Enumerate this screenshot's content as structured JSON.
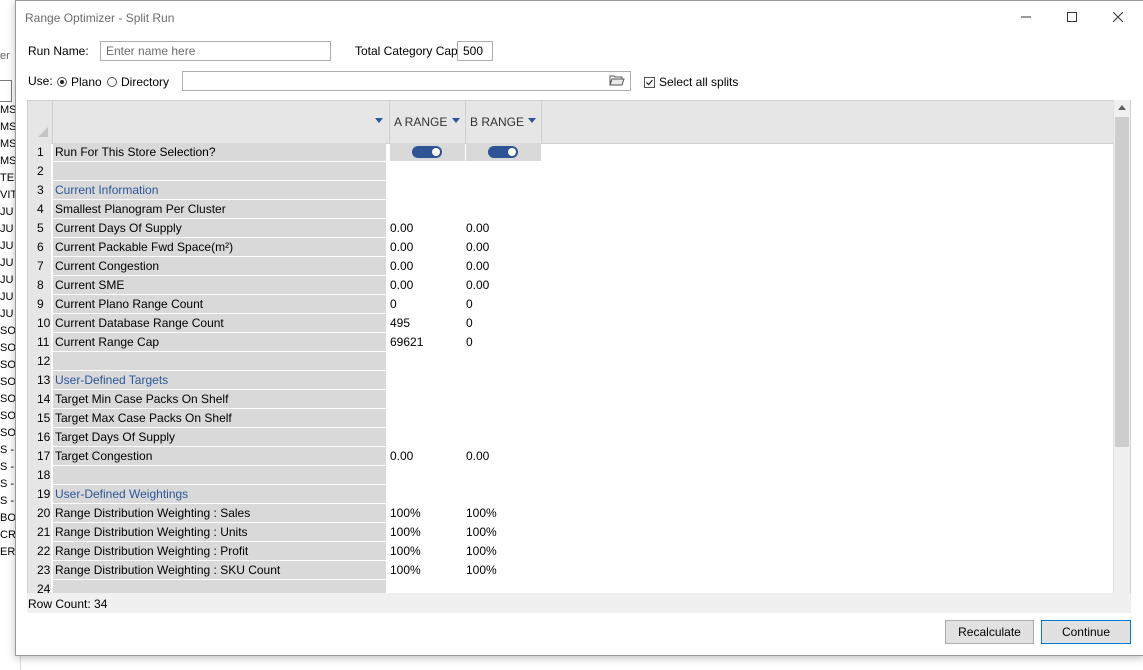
{
  "background_app": {
    "label": "er",
    "list": [
      "MS",
      "MS",
      "MS",
      "MS",
      "TEM",
      "VIT",
      "JU",
      "JU",
      "JU",
      "JU",
      "JU",
      "JU",
      "JU",
      "SO",
      "SO",
      "SO",
      "SO",
      "SO",
      "SO",
      "SO",
      "S - A",
      "S - E",
      "S - E",
      "S - E",
      "BOD",
      "CRE",
      "ERA"
    ]
  },
  "window": {
    "title": "Range Optimizer - Split Run",
    "minimize_icon": "minimize-icon",
    "maximize_icon": "maximize-icon",
    "close_icon": "close-icon"
  },
  "form": {
    "run_name_label": "Run Name:",
    "run_name_placeholder": "Enter name here",
    "run_name_value": "",
    "category_cap_label": "Total Category Cap:",
    "category_cap_value": "500",
    "use_label": "Use:",
    "use_options": [
      {
        "label": "Plano",
        "checked": true
      },
      {
        "label": "Directory",
        "checked": false
      }
    ],
    "path_value": "",
    "folder_icon": "folder-open-icon",
    "select_all_label": "Select all splits",
    "select_all_checked": true
  },
  "grid": {
    "columns": [
      "",
      "A RANGE",
      "B RANGE"
    ],
    "rows": [
      {
        "num": "1",
        "label": "Run For This Store Selection?",
        "type": "toggle",
        "a": true,
        "b": true
      },
      {
        "num": "2",
        "label": "",
        "type": "blank",
        "a": "",
        "b": ""
      },
      {
        "num": "3",
        "label": "Current Information",
        "type": "section",
        "a": "",
        "b": ""
      },
      {
        "num": "4",
        "label": "Smallest Planogram Per Cluster",
        "type": "value",
        "a": "",
        "b": ""
      },
      {
        "num": "5",
        "label": "Current Days Of Supply",
        "type": "value",
        "a": "0.00",
        "b": "0.00"
      },
      {
        "num": "6",
        "label": "Current Packable Fwd Space(m²)",
        "type": "value",
        "a": "0.00",
        "b": "0.00"
      },
      {
        "num": "7",
        "label": "Current Congestion",
        "type": "value",
        "a": "0.00",
        "b": "0.00"
      },
      {
        "num": "8",
        "label": "Current SME",
        "type": "value",
        "a": "0.00",
        "b": "0.00"
      },
      {
        "num": "9",
        "label": "Current Plano Range Count",
        "type": "value",
        "a": "0",
        "b": "0"
      },
      {
        "num": "10",
        "label": "Current Database Range Count",
        "type": "value",
        "a": "495",
        "b": "0"
      },
      {
        "num": "11",
        "label": "Current Range Cap",
        "type": "value",
        "a": "69621",
        "b": "0"
      },
      {
        "num": "12",
        "label": "",
        "type": "blank",
        "a": "",
        "b": ""
      },
      {
        "num": "13",
        "label": "User-Defined Targets",
        "type": "section",
        "a": "",
        "b": ""
      },
      {
        "num": "14",
        "label": "Target Min Case Packs On Shelf",
        "type": "value",
        "a": "",
        "b": ""
      },
      {
        "num": "15",
        "label": "Target Max Case Packs On Shelf",
        "type": "value",
        "a": "",
        "b": ""
      },
      {
        "num": "16",
        "label": "Target Days Of Supply",
        "type": "value",
        "a": "",
        "b": ""
      },
      {
        "num": "17",
        "label": "Target Congestion",
        "type": "value",
        "a": "0.00",
        "b": "0.00"
      },
      {
        "num": "18",
        "label": "",
        "type": "blank",
        "a": "",
        "b": ""
      },
      {
        "num": "19",
        "label": "User-Defined Weightings",
        "type": "section",
        "a": "",
        "b": ""
      },
      {
        "num": "20",
        "label": "Range Distribution Weighting : Sales",
        "type": "value",
        "a": "100%",
        "b": "100%"
      },
      {
        "num": "21",
        "label": "Range Distribution Weighting : Units",
        "type": "value",
        "a": "100%",
        "b": "100%"
      },
      {
        "num": "22",
        "label": "Range Distribution Weighting : Profit",
        "type": "value",
        "a": "100%",
        "b": "100%"
      },
      {
        "num": "23",
        "label": "Range Distribution Weighting : SKU Count",
        "type": "value",
        "a": "100%",
        "b": "100%"
      },
      {
        "num": "24",
        "label": "",
        "type": "blank",
        "a": "",
        "b": ""
      }
    ],
    "row_count_text": "Row Count: 34"
  },
  "buttons": {
    "recalculate": "Recalculate",
    "continue": "Continue"
  },
  "colors": {
    "accent": "#2b579a",
    "toggle": "#2f5496",
    "row_label_bg": "#d9d9d9",
    "header_bg": "#e6e6e6"
  }
}
